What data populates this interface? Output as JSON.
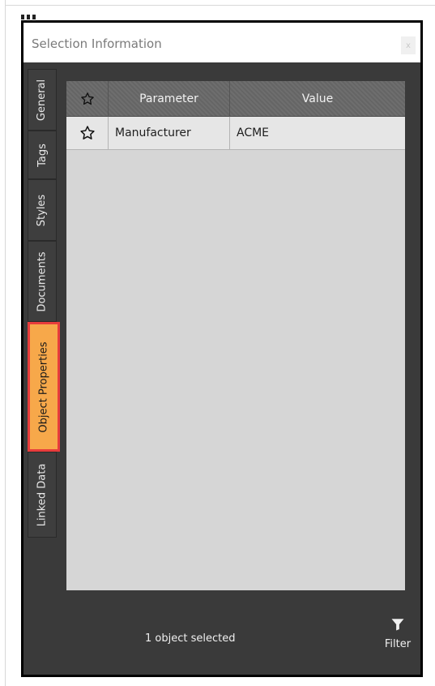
{
  "window": {
    "title": "Selection Information",
    "close_label": "x"
  },
  "tabs": [
    {
      "label": "General",
      "active": false
    },
    {
      "label": "Tags",
      "active": false
    },
    {
      "label": "Styles",
      "active": false
    },
    {
      "label": "Documents",
      "active": false
    },
    {
      "label": "Object Properties",
      "active": true
    },
    {
      "label": "Linked Data",
      "active": false
    }
  ],
  "table": {
    "columns": [
      "",
      "Parameter",
      "Value"
    ],
    "rows": [
      {
        "starred": false,
        "parameter": "Manufacturer",
        "value": "ACME"
      }
    ]
  },
  "footer": {
    "status": "1 object selected",
    "filter_label": "Filter"
  },
  "colors": {
    "active_tab": "#f7a84a",
    "active_tab_outline": "#e83c3c",
    "panel_bg": "#3a3a3a",
    "grid_bg": "#d6d6d6"
  },
  "icons": [
    "star-icon",
    "filter-icon"
  ]
}
